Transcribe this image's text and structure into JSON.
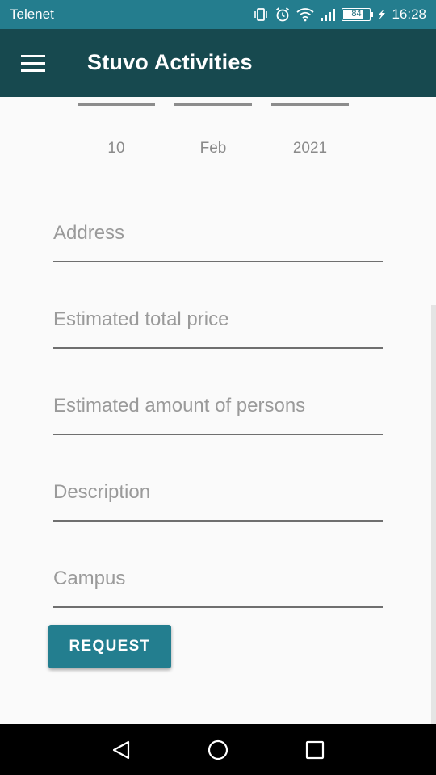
{
  "status_bar": {
    "carrier": "Telenet",
    "battery": "84",
    "time": "16:28",
    "icons": [
      "vibrate-icon",
      "alarm-icon",
      "wifi-icon",
      "signal-icon",
      "battery-icon",
      "charging-icon"
    ]
  },
  "app_bar": {
    "title": "Stuvo Activities",
    "menu_icon": "hamburger-menu-icon"
  },
  "date_picker": {
    "day": "10",
    "month": "Feb",
    "year": "2021"
  },
  "form": {
    "fields": [
      {
        "label": "Address"
      },
      {
        "label": "Estimated total price"
      },
      {
        "label": "Estimated amount of persons"
      },
      {
        "label": "Description"
      },
      {
        "label": "Campus"
      }
    ],
    "submit_label": "REQUEST"
  },
  "nav_bar": {
    "buttons": [
      "back-icon",
      "home-icon",
      "recents-icon"
    ]
  },
  "colors": {
    "status_bar": "#247d8e",
    "app_bar": "#17494f",
    "accent": "#237e8f",
    "background": "#fafafa"
  }
}
